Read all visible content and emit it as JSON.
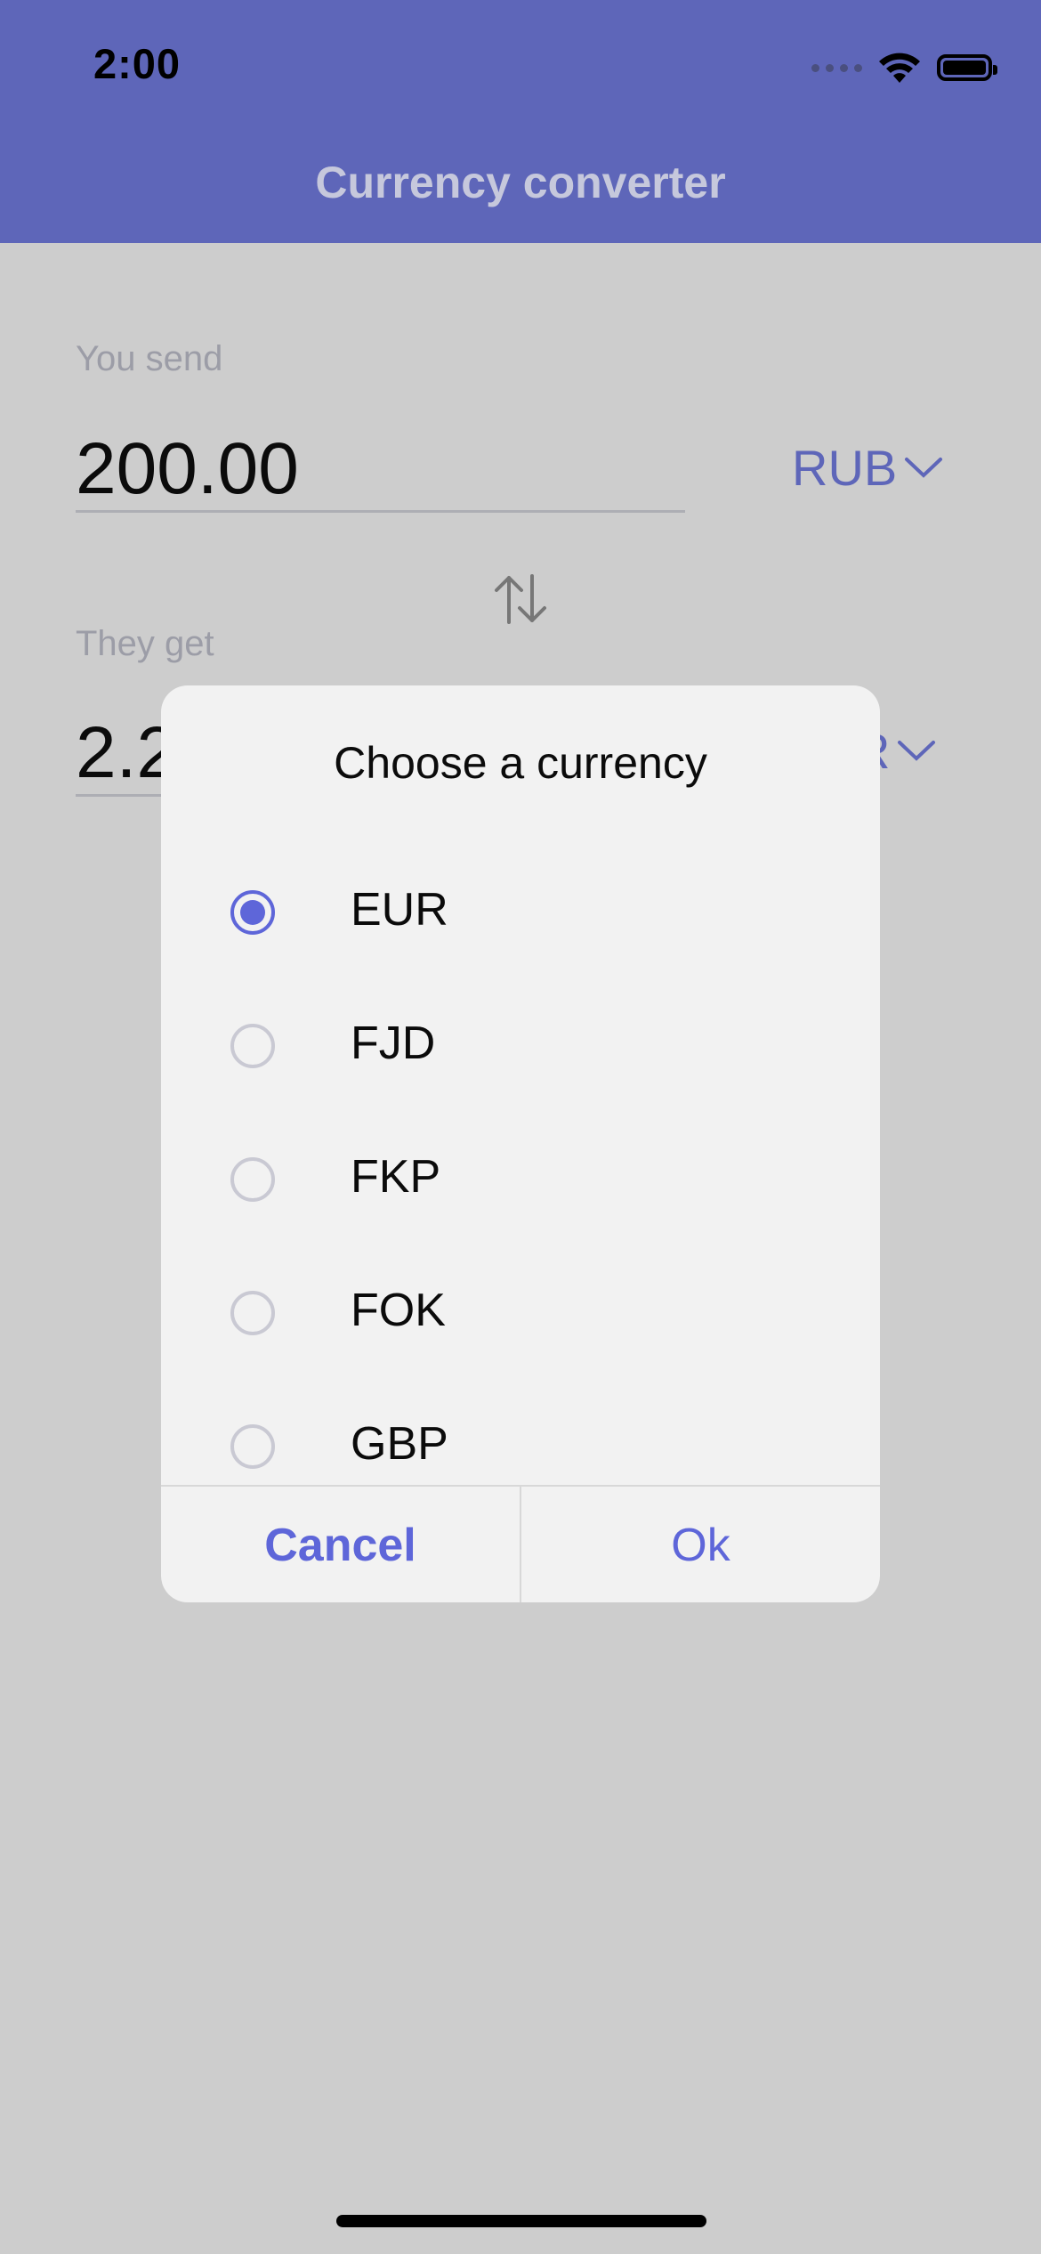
{
  "status_bar": {
    "time": "2:00",
    "icons": [
      "cellular-signal-icon",
      "wifi-icon",
      "battery-icon"
    ]
  },
  "header": {
    "title": "Currency converter"
  },
  "send": {
    "label": "You send",
    "amount": "200.00",
    "currency": "RUB"
  },
  "swap": {
    "icon": "swap-arrows-icon"
  },
  "receive": {
    "label": "They get",
    "amount": "2.2",
    "currency_partial": "R"
  },
  "dialog": {
    "title": "Choose a currency",
    "options": [
      {
        "code": "EUR",
        "selected": true
      },
      {
        "code": "FJD",
        "selected": false
      },
      {
        "code": "FKP",
        "selected": false
      },
      {
        "code": "FOK",
        "selected": false
      },
      {
        "code": "GBP",
        "selected": false
      }
    ],
    "cancel_label": "Cancel",
    "ok_label": "Ok"
  },
  "colors": {
    "accent": "#5e66b9",
    "radio_accent": "#5e66d9",
    "overlay_bg": "#cdcdcd",
    "dialog_bg": "#f2f2f2"
  }
}
